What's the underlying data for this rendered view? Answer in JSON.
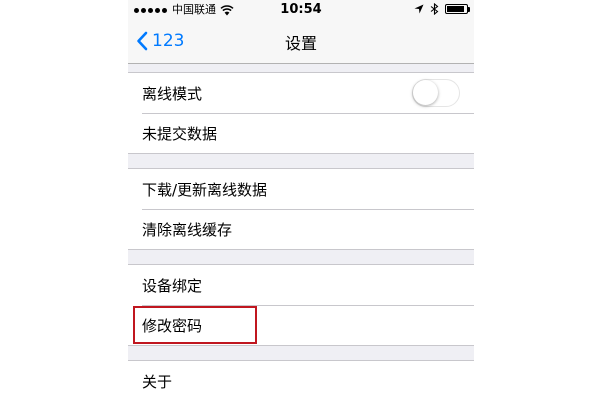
{
  "status_bar": {
    "carrier": "中国联通",
    "time": "10:54",
    "battery_level": 0.9
  },
  "nav": {
    "back_label": "123",
    "title": "设置"
  },
  "groups": [
    {
      "items": [
        {
          "label": "离线模式",
          "toggle": true,
          "toggle_on": false
        },
        {
          "label": "未提交数据"
        }
      ]
    },
    {
      "items": [
        {
          "label": "下载/更新离线数据"
        },
        {
          "label": "清除离线缓存"
        }
      ]
    },
    {
      "items": [
        {
          "label": "设备绑定"
        },
        {
          "label": "修改密码",
          "highlighted": true
        }
      ]
    },
    {
      "items": [
        {
          "label": "关于"
        }
      ]
    }
  ],
  "colors": {
    "accent": "#007aff",
    "highlight": "#c0161f",
    "background": "#efeff4"
  },
  "icons": [
    "signal-dot-icon",
    "wifi-icon",
    "location-arrow-icon",
    "bluetooth-icon",
    "battery-icon",
    "chevron-left-icon"
  ]
}
